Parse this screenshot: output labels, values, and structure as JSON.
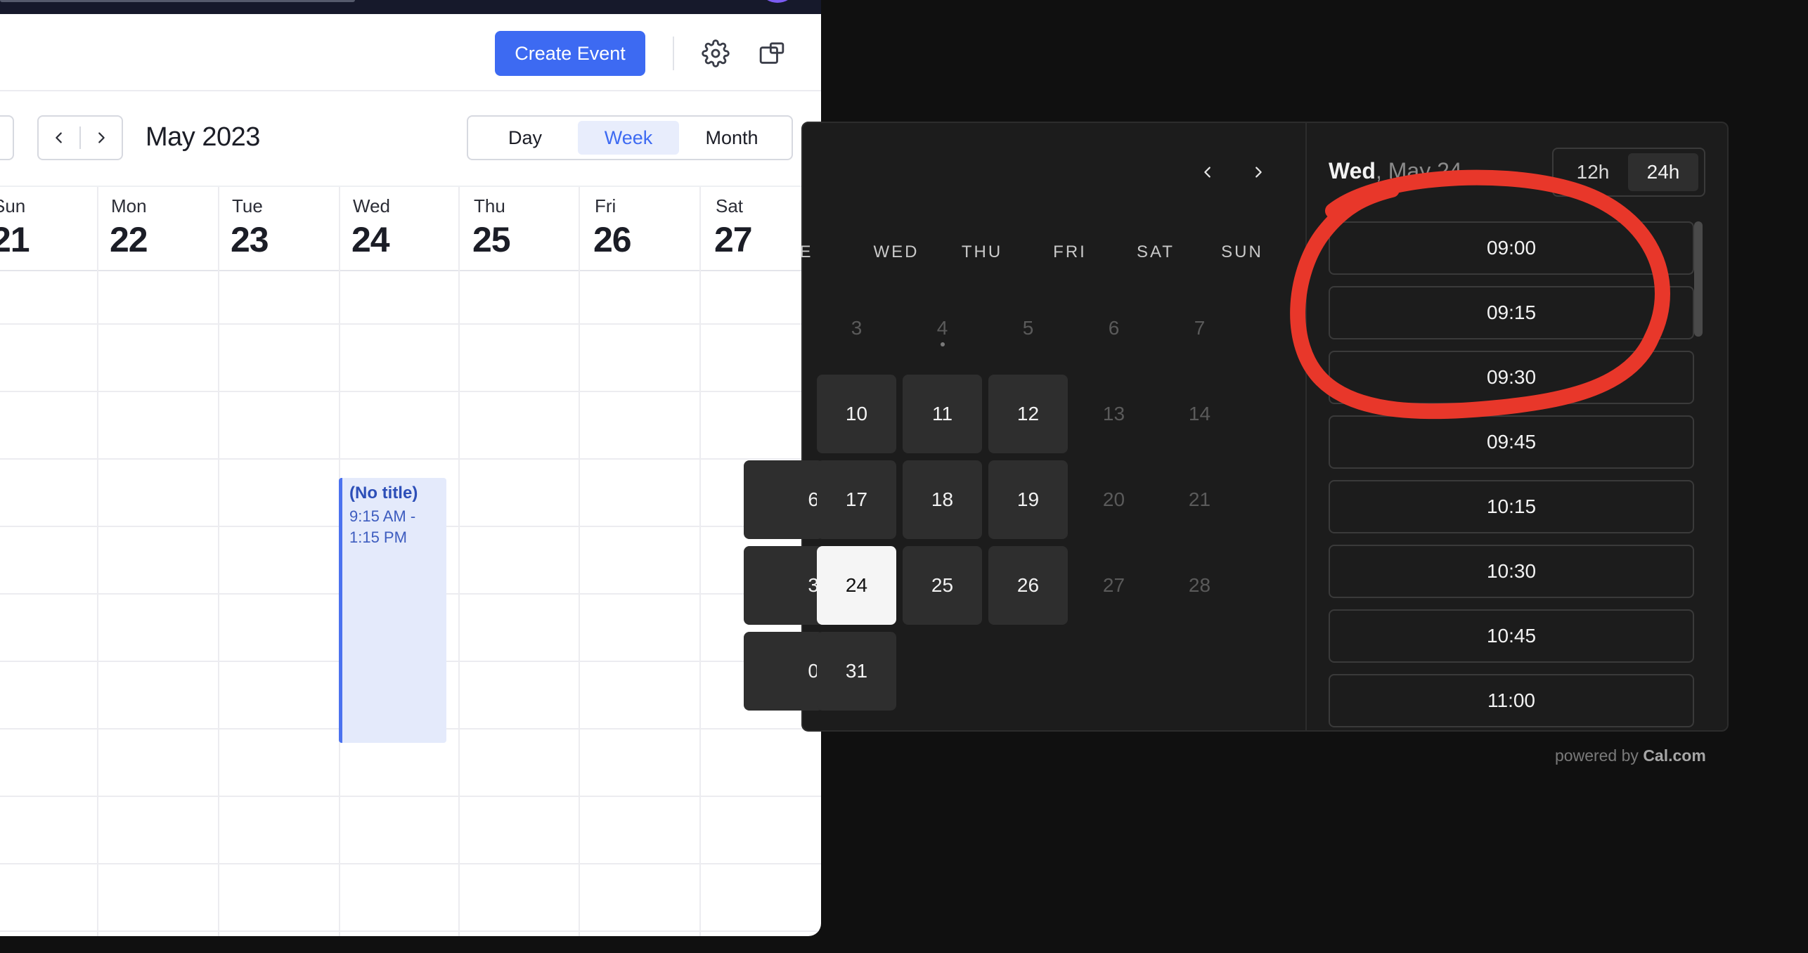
{
  "calendar": {
    "header": {
      "create_event_label": "Create Event"
    },
    "toolbar": {
      "month_label": "May 2023",
      "views": [
        "Day",
        "Week",
        "Month"
      ],
      "active_view": "Week"
    },
    "week_days": [
      {
        "name": "Sun",
        "num": "21"
      },
      {
        "name": "Mon",
        "num": "22"
      },
      {
        "name": "Tue",
        "num": "23"
      },
      {
        "name": "Wed",
        "num": "24"
      },
      {
        "name": "Thu",
        "num": "25"
      },
      {
        "name": "Fri",
        "num": "26"
      },
      {
        "name": "Sat",
        "num": "27"
      }
    ],
    "event": {
      "title": "(No title)",
      "time": "9:15 AM - 1:15 PM"
    }
  },
  "booker": {
    "weekday_headers": [
      "E",
      "WED",
      "THU",
      "FRI",
      "SAT",
      "SUN"
    ],
    "month_grid": [
      [
        "",
        "3",
        "4",
        "5",
        "6",
        "7"
      ],
      [
        "",
        "10",
        "11",
        "12",
        "13",
        "14"
      ],
      [
        "6",
        "17",
        "18",
        "19",
        "20",
        "21"
      ],
      [
        "3",
        "24",
        "25",
        "26",
        "27",
        "28"
      ],
      [
        "0",
        "31"
      ]
    ],
    "selected_weekday": "Wed",
    "selected_date_rest": ", May 24",
    "time_format_options": [
      "12h",
      "24h"
    ],
    "active_time_format": "24h",
    "slots": [
      "09:00",
      "09:15",
      "09:30",
      "09:45",
      "10:15",
      "10:30",
      "10:45",
      "11:00"
    ],
    "powered_by_prefix": "powered by ",
    "powered_by_brand": "Cal.com"
  },
  "colors": {
    "accent_blue": "#3d6af2",
    "event_bg": "#e4eafb",
    "booker_bg": "#1c1c1c",
    "annotation_red": "#e8372a"
  },
  "icons": {
    "settings": "gear-icon",
    "popout": "popout-window-icon",
    "prev": "chevron-left-icon",
    "next": "chevron-right-icon"
  }
}
